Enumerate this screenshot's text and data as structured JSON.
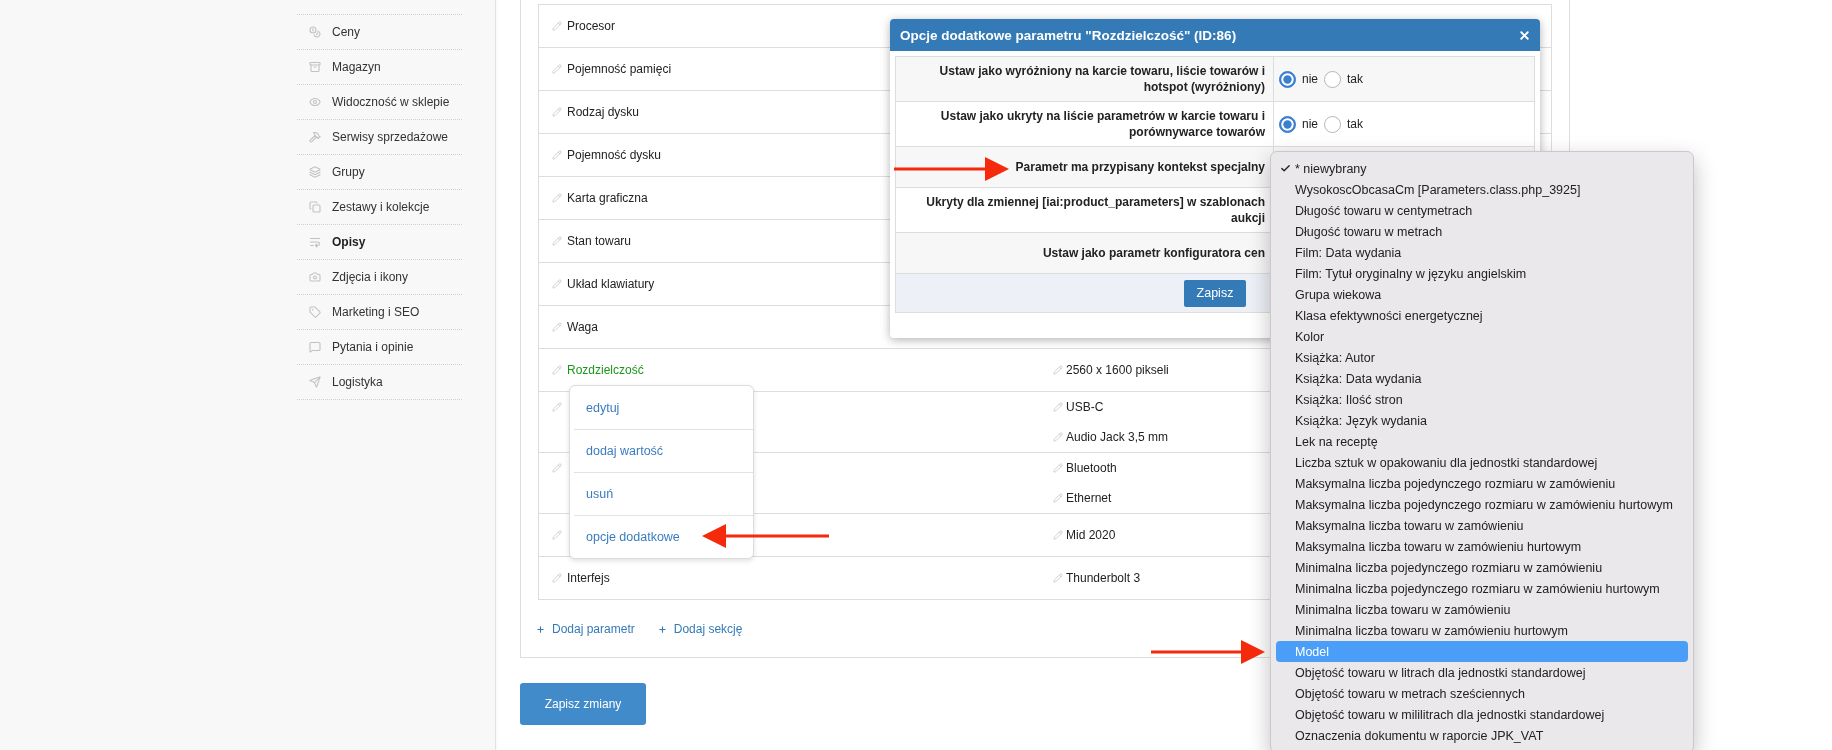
{
  "sidebar": {
    "items": [
      {
        "label": "Ceny",
        "selected": false
      },
      {
        "label": "Magazyn",
        "selected": false
      },
      {
        "label": "Widoczność w sklepie",
        "selected": false
      },
      {
        "label": "Serwisy sprzedażowe",
        "selected": false
      },
      {
        "label": "Grupy",
        "selected": false
      },
      {
        "label": "Zestawy i kolekcje",
        "selected": false
      },
      {
        "label": "Opisy",
        "selected": true
      },
      {
        "label": "Zdjęcia i ikony",
        "selected": false
      },
      {
        "label": "Marketing i SEO",
        "selected": false
      },
      {
        "label": "Pytania i opinie",
        "selected": false
      },
      {
        "label": "Logistyka",
        "selected": false
      }
    ]
  },
  "parameters": {
    "rows": [
      {
        "name": "Procesor",
        "active": false
      },
      {
        "name": "Pojemność pamięci",
        "active": false
      },
      {
        "name": "Rodzaj dysku",
        "active": false
      },
      {
        "name": "Pojemność dysku",
        "active": false
      },
      {
        "name": "Karta graficzna",
        "active": false
      },
      {
        "name": "Stan towaru",
        "active": false
      },
      {
        "name": "Układ klawiatury",
        "active": false
      },
      {
        "name": "Waga",
        "active": false
      },
      {
        "name": "Rozdzielczość",
        "active": true,
        "values": [
          "2560 x 1600 pikseli"
        ]
      },
      {
        "values": [
          "USB-C",
          "Audio Jack 3,5 mm"
        ]
      },
      {
        "values": [
          "Bluetooth",
          "Ethernet"
        ]
      },
      {
        "values": [
          "Mid 2020"
        ]
      },
      {
        "name": "Interfejs",
        "active": false,
        "values": [
          "Thunderbolt 3"
        ]
      }
    ],
    "row_menu": {
      "items": [
        "edytuj",
        "dodaj wartość",
        "usuń",
        "opcje dodatkowe"
      ]
    },
    "add_links": [
      "Dodaj parametr",
      "Dodaj sekcję"
    ]
  },
  "save_button": "Zapisz zmiany",
  "dialog": {
    "title": "Opcje dodatkowe parametru \"Rozdzielczość\" (ID:86)",
    "options": [
      {
        "label": "Ustaw jako wyróżniony na karcie towaru, liście towarów i hotspot (wyróżniony)",
        "choices": [
          {
            "label": "nie",
            "selected": true
          },
          {
            "label": "tak",
            "selected": false
          }
        ]
      },
      {
        "label": "Ustaw jako ukryty na liście parametrów w karcie towaru i porównywarce towarów",
        "choices": [
          {
            "label": "nie",
            "selected": true
          },
          {
            "label": "tak",
            "selected": false
          }
        ]
      },
      {
        "label": "Parametr ma przypisany kontekst specjalny",
        "dropdown": {
          "options": [
            {
              "label": "* niewybrany",
              "selected": true,
              "highlighted": false
            },
            {
              "label": "WysokoscObcasaCm [Parameters.class.php_3925]",
              "selected": false,
              "highlighted": false
            },
            {
              "label": "Długość towaru w centymetrach",
              "selected": false,
              "highlighted": false
            },
            {
              "label": "Długość towaru w metrach",
              "selected": false,
              "highlighted": false
            },
            {
              "label": "Film: Data wydania",
              "selected": false,
              "highlighted": false
            },
            {
              "label": "Film: Tytuł oryginalny w języku angielskim",
              "selected": false,
              "highlighted": false
            },
            {
              "label": "Grupa wiekowa",
              "selected": false,
              "highlighted": false
            },
            {
              "label": "Klasa efektywności energetycznej",
              "selected": false,
              "highlighted": false
            },
            {
              "label": "Kolor",
              "selected": false,
              "highlighted": false
            },
            {
              "label": "Książka: Autor",
              "selected": false,
              "highlighted": false
            },
            {
              "label": "Książka: Data wydania",
              "selected": false,
              "highlighted": false
            },
            {
              "label": "Książka: Ilość stron",
              "selected": false,
              "highlighted": false
            },
            {
              "label": "Książka: Język wydania",
              "selected": false,
              "highlighted": false
            },
            {
              "label": "Lek na receptę",
              "selected": false,
              "highlighted": false
            },
            {
              "label": "Liczba sztuk w opakowaniu dla jednostki standardowej",
              "selected": false,
              "highlighted": false
            },
            {
              "label": "Maksymalna liczba pojedynczego rozmiaru w zamówieniu",
              "selected": false,
              "highlighted": false
            },
            {
              "label": "Maksymalna liczba pojedynczego rozmiaru w zamówieniu hurtowym",
              "selected": false,
              "highlighted": false
            },
            {
              "label": "Maksymalna liczba towaru w zamówieniu",
              "selected": false,
              "highlighted": false
            },
            {
              "label": "Maksymalna liczba towaru w zamówieniu hurtowym",
              "selected": false,
              "highlighted": false
            },
            {
              "label": "Minimalna liczba pojedynczego rozmiaru w zamówieniu",
              "selected": false,
              "highlighted": false
            },
            {
              "label": "Minimalna liczba pojedynczego rozmiaru w zamówieniu hurtowym",
              "selected": false,
              "highlighted": false
            },
            {
              "label": "Minimalna liczba towaru w zamówieniu",
              "selected": false,
              "highlighted": false
            },
            {
              "label": "Minimalna liczba towaru w zamówieniu hurtowym",
              "selected": false,
              "highlighted": false
            },
            {
              "label": "Model",
              "selected": false,
              "highlighted": true
            },
            {
              "label": "Objętość towaru w litrach dla jednostki standardowej",
              "selected": false,
              "highlighted": false
            },
            {
              "label": "Objętość towaru w metrach sześciennych",
              "selected": false,
              "highlighted": false
            },
            {
              "label": "Objętość towaru w mililitrach dla jednostki standardowej",
              "selected": false,
              "highlighted": false
            },
            {
              "label": "Oznaczenia dokumentu w raporcie JPK_VAT",
              "selected": false,
              "highlighted": false
            }
          ]
        }
      },
      {
        "label": "Ukryty dla zmiennej [iai:product_parameters] w szablonach aukcji"
      },
      {
        "label": "Ustaw jako parametr konfiguratora cen"
      }
    ],
    "save_button": "Zapisz"
  }
}
